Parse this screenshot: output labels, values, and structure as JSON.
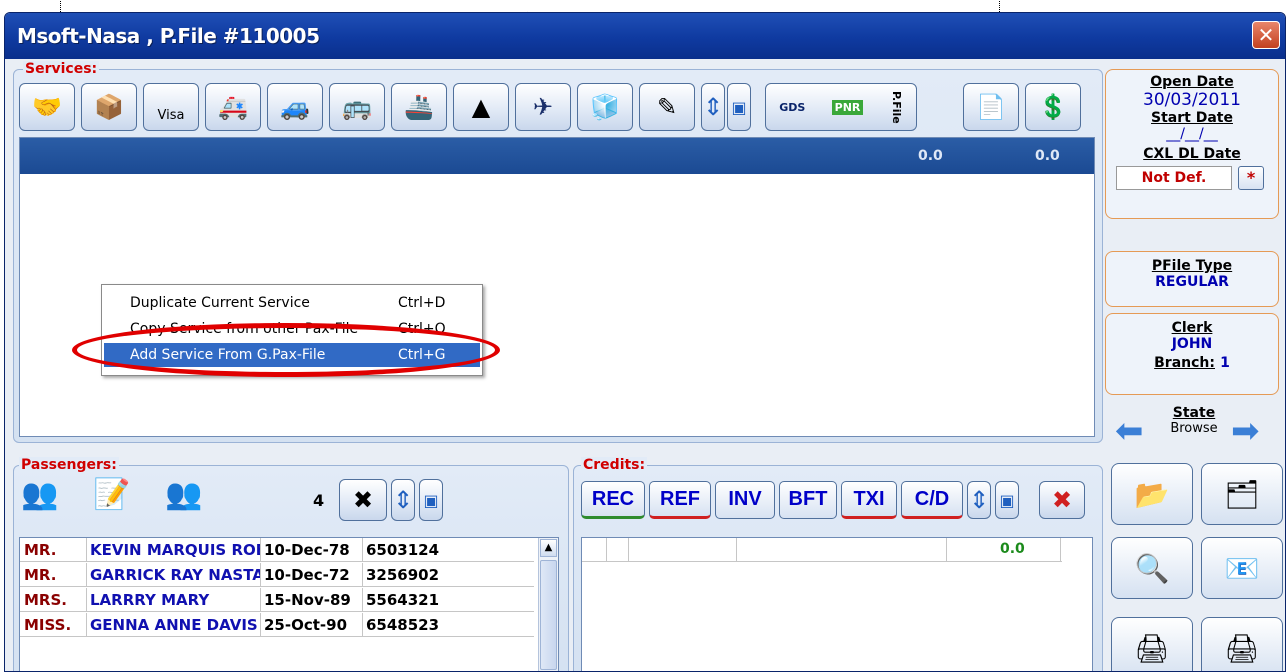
{
  "window": {
    "title": "Msoft-Nasa , P.File #110005",
    "close_icon": "close-icon"
  },
  "services": {
    "label": "Services:",
    "toolbar_icons": [
      "handshake-icon",
      "package-icon",
      "visa-icon",
      "ambulance-icon",
      "car-icon",
      "bus-icon",
      "ship-icon",
      "pyramid-icon",
      "airplane-icon",
      "cubes-icon",
      "pencil-icon",
      "up-down-arrows-icon",
      "save-icon",
      "gds-pnr-pfile-icon",
      "document-icon",
      "money-document-icon"
    ],
    "visa_label": "Visa",
    "gds_label": "GDS",
    "pnr_label": "PNR",
    "pfile_label": "P.File",
    "totals": [
      "0.0",
      "0.0"
    ]
  },
  "context_menu": {
    "items": [
      {
        "label": "Duplicate Current Service",
        "shortcut": "Ctrl+D"
      },
      {
        "label": "Copy Service from other Pax-File",
        "shortcut": "Ctrl+O"
      },
      {
        "label": "Add Service From G.Pax-File",
        "shortcut": "Ctrl+G",
        "selected": true
      }
    ]
  },
  "right_panel": {
    "open_date_label": "Open Date",
    "open_date": "30/03/2011",
    "start_date_label": "Start Date",
    "start_date": "__/__/__",
    "cxl_dl_date_label": "CXL DL Date",
    "cxl_dl_date": "Not Def.",
    "cxl_button": "*",
    "pfile_type_label": "PFile Type",
    "pfile_type": "REGULAR",
    "clerk_label": "Clerk",
    "clerk": "JOHN",
    "branch_label": "Branch:",
    "branch": "1",
    "state_label": "State",
    "state": "Browse"
  },
  "passengers": {
    "label": "Passengers:",
    "count": "4",
    "rows": [
      {
        "title": "MR.",
        "name": "KEVIN MARQUIS ROBI",
        "dob": "10-Dec-78",
        "number": "6503124"
      },
      {
        "title": "MR.",
        "name": "GARRICK RAY NASTAS",
        "dob": "10-Dec-72",
        "number": "3256902"
      },
      {
        "title": "MRS.",
        "name": "LARRRY MARY",
        "dob": "15-Nov-89",
        "number": "5564321"
      },
      {
        "title": "MISS.",
        "name": "GENNA ANNE DAVIS",
        "dob": "25-Oct-90",
        "number": "6548523"
      }
    ]
  },
  "credits": {
    "label": "Credits:",
    "buttons": [
      "REC",
      "REF",
      "INV",
      "BFT",
      "TXI",
      "C/D"
    ],
    "total": "0.0"
  },
  "colors": {
    "title_bar": "#0f3aa0",
    "highlight": "#e00000",
    "selection": "#316ac5"
  }
}
